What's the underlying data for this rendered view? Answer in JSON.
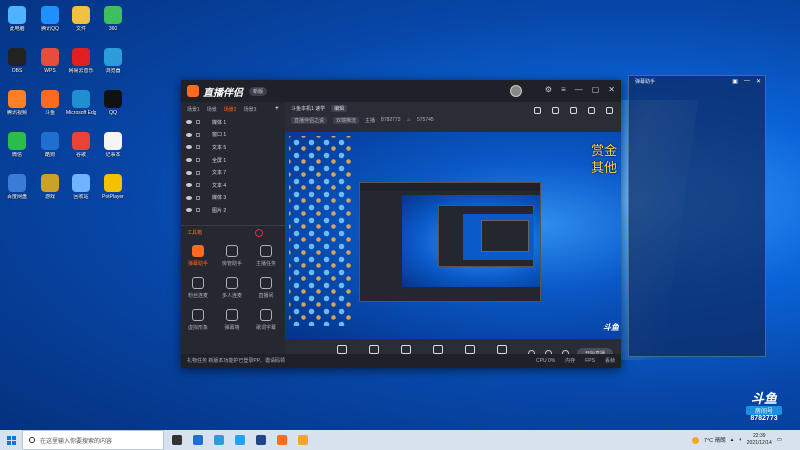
{
  "desktop": {
    "icons": [
      {
        "label": "此电脑",
        "color": "#4fb3ff"
      },
      {
        "label": "腾讯QQ",
        "color": "#1e90ff"
      },
      {
        "label": "文件",
        "color": "#f0c040"
      },
      {
        "label": "360",
        "color": "#3fbf5f"
      },
      {
        "label": "OBS",
        "color": "#222222"
      },
      {
        "label": "WPS",
        "color": "#e74c3c"
      },
      {
        "label": "网易云音乐",
        "color": "#e02020"
      },
      {
        "label": "浏览器",
        "color": "#2d9cdb"
      },
      {
        "label": "腾讯视频",
        "color": "#ff7f27"
      },
      {
        "label": "斗鱼",
        "color": "#ff6a1f"
      },
      {
        "label": "Microsoft Edge",
        "color": "#1f8fd1"
      },
      {
        "label": "QQ",
        "color": "#111111"
      },
      {
        "label": "微信",
        "color": "#2bbd4a"
      },
      {
        "label": "酷狗",
        "color": "#1f6fd1"
      },
      {
        "label": "谷歌",
        "color": "#ea4335"
      },
      {
        "label": "记事本",
        "color": "#f5f5f5"
      },
      {
        "label": "百度网盘",
        "color": "#3a7bd5"
      },
      {
        "label": "游戏",
        "color": "#c9a227"
      },
      {
        "label": "回收站",
        "color": "#6fb4ff"
      },
      {
        "label": "PotPlayer",
        "color": "#f2c200"
      }
    ]
  },
  "app": {
    "name": "直播伴侣",
    "version_badge": "新版",
    "tabs": [
      {
        "label": "场景1",
        "active": false
      },
      {
        "label": "场景",
        "active": false
      },
      {
        "label": "场景2",
        "active": true
      },
      {
        "label": "场景3",
        "active": false
      }
    ],
    "layers": [
      {
        "name": "媒体 1"
      },
      {
        "name": "窗口 1"
      },
      {
        "name": "文本 5"
      },
      {
        "name": "全屏 1"
      },
      {
        "name": "文本 7"
      },
      {
        "name": "文本 4"
      },
      {
        "name": "媒体 3"
      },
      {
        "name": "图片 2"
      }
    ],
    "tools_header": "工具箱",
    "tools": [
      {
        "label": "弹幕助手",
        "hot": true
      },
      {
        "label": "房管助手",
        "hot": false
      },
      {
        "label": "主播任务",
        "hot": false
      },
      {
        "label": "粉丝连麦",
        "hot": false
      },
      {
        "label": "多人连麦",
        "hot": false
      },
      {
        "label": "直播间",
        "hot": false
      },
      {
        "label": "虚拟形象",
        "hot": false
      },
      {
        "label": "弹幕墙",
        "hot": false
      },
      {
        "label": "歌词字幕",
        "hot": false
      }
    ],
    "room": {
      "title": "斗鱼本机1 速学",
      "edit_label": "编辑",
      "category": "直播伴侣之说",
      "subcategory": "双端推流",
      "host_label": "主播",
      "room_id": "8782773",
      "fans": "575745"
    },
    "overlay_lines": [
      "赏金",
      "其他"
    ],
    "watermark": "斗鱼",
    "controls": [
      {
        "label": "直播屏幕"
      },
      {
        "label": "摄像头"
      },
      {
        "label": "手机投屏"
      },
      {
        "label": "多媒体"
      },
      {
        "label": "麦克风"
      },
      {
        "label": "扬声器"
      }
    ],
    "start_live": "开始直播",
    "status_left": "礼物任务  新版本功能护已登录PP、邀请码领",
    "status_right": [
      "CPU 0%",
      "内存",
      "FPS",
      "丢帧"
    ]
  },
  "preview": {
    "title": "弹幕助手"
  },
  "taskbar": {
    "search_placeholder": "在这里输入你要搜索的内容",
    "weather": "7°C 晴朗",
    "time": "22:39",
    "date": "2021/12/14",
    "tray_app_colors": [
      "#333333",
      "#1f6fd1",
      "#2d9cdb",
      "#1fa2ff",
      "#224488",
      "#ff6a1f",
      "#f5a623"
    ]
  },
  "douyu_badge": {
    "brand": "斗鱼",
    "room_label": "房间号",
    "room_number": "8782773"
  }
}
